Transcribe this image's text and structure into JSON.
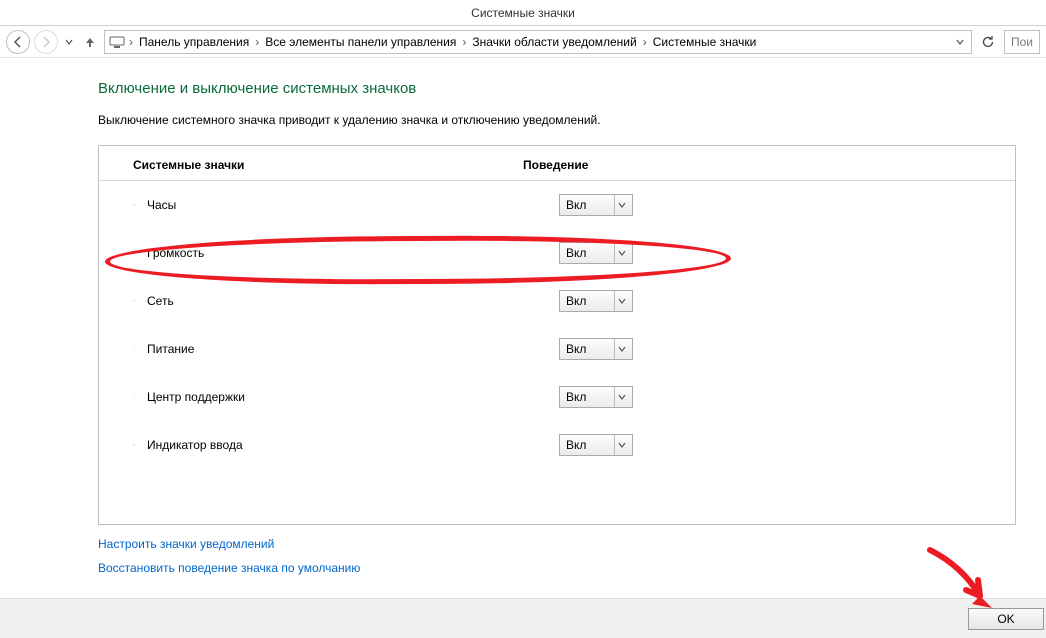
{
  "window": {
    "title": "Системные значки"
  },
  "toolbar": {
    "breadcrumbs": [
      "Панель управления",
      "Все элементы панели управления",
      "Значки области уведомлений",
      "Системные значки"
    ],
    "search_placeholder": "Пои"
  },
  "page": {
    "title": "Включение и выключение системных значков",
    "subtitle": "Выключение системного значка приводит к удалению значка и отключению уведомлений."
  },
  "table": {
    "header_name": "Системные значки",
    "header_behavior": "Поведение",
    "rows": [
      {
        "icon": "clock-icon",
        "label": "Часы",
        "value": "Вкл"
      },
      {
        "icon": "volume-icon",
        "label": "Громкость",
        "value": "Вкл"
      },
      {
        "icon": "network-icon",
        "label": "Сеть",
        "value": "Вкл"
      },
      {
        "icon": "power-icon",
        "label": "Питание",
        "value": "Вкл"
      },
      {
        "icon": "flag-icon",
        "label": "Центр поддержки",
        "value": "Вкл"
      },
      {
        "icon": "keyboard-icon",
        "label": "Индикатор ввода",
        "value": "Вкл"
      }
    ]
  },
  "links": {
    "configure": "Настроить значки уведомлений",
    "restore": "Восстановить поведение значка по умолчанию"
  },
  "buttons": {
    "ok": "OK"
  }
}
